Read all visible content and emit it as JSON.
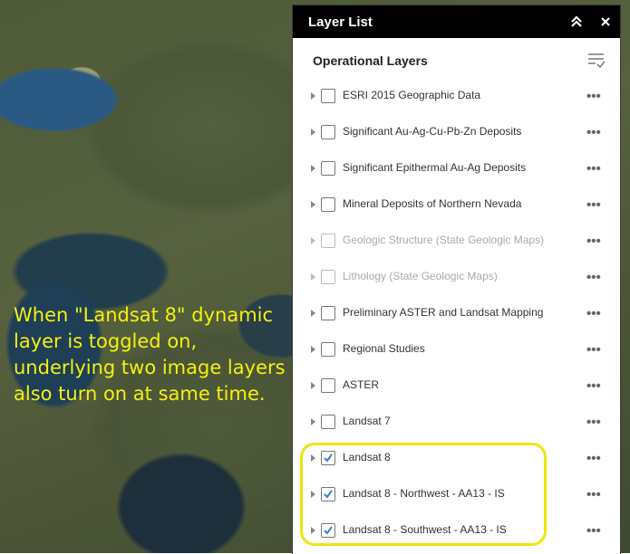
{
  "map": {
    "caption": "When \"Landsat 8\" dynamic layer is toggled on, underlying two image layers also turn on at same time."
  },
  "panel": {
    "title": "Layer List",
    "section_title": "Operational Layers",
    "more_glyph": "•••",
    "layers": [
      {
        "label": "ESRI 2015 Geographic Data",
        "checked": false,
        "dimmed": false
      },
      {
        "label": "Significant Au-Ag-Cu-Pb-Zn Deposits",
        "checked": false,
        "dimmed": false
      },
      {
        "label": "Significant Epithermal Au-Ag Deposits",
        "checked": false,
        "dimmed": false
      },
      {
        "label": "Mineral Deposits of Northern Nevada",
        "checked": false,
        "dimmed": false
      },
      {
        "label": "Geologic Structure (State Geologic Maps)",
        "checked": false,
        "dimmed": true
      },
      {
        "label": "Lithology (State Geologic Maps)",
        "checked": false,
        "dimmed": true
      },
      {
        "label": "Preliminary ASTER and Landsat Mapping",
        "checked": false,
        "dimmed": false
      },
      {
        "label": "Regional Studies",
        "checked": false,
        "dimmed": false
      },
      {
        "label": "ASTER",
        "checked": false,
        "dimmed": false
      },
      {
        "label": "Landsat 7",
        "checked": false,
        "dimmed": false
      },
      {
        "label": "Landsat 8",
        "checked": true,
        "dimmed": false
      },
      {
        "label": "Landsat 8 - Northwest - AA13 - IS",
        "checked": true,
        "dimmed": false
      },
      {
        "label": "Landsat 8 - Southwest - AA13 - IS",
        "checked": true,
        "dimmed": false
      }
    ]
  },
  "colors": {
    "check_accent": "#2f7fd1",
    "highlight": "#ede60e",
    "caption": "#f4f10e"
  }
}
